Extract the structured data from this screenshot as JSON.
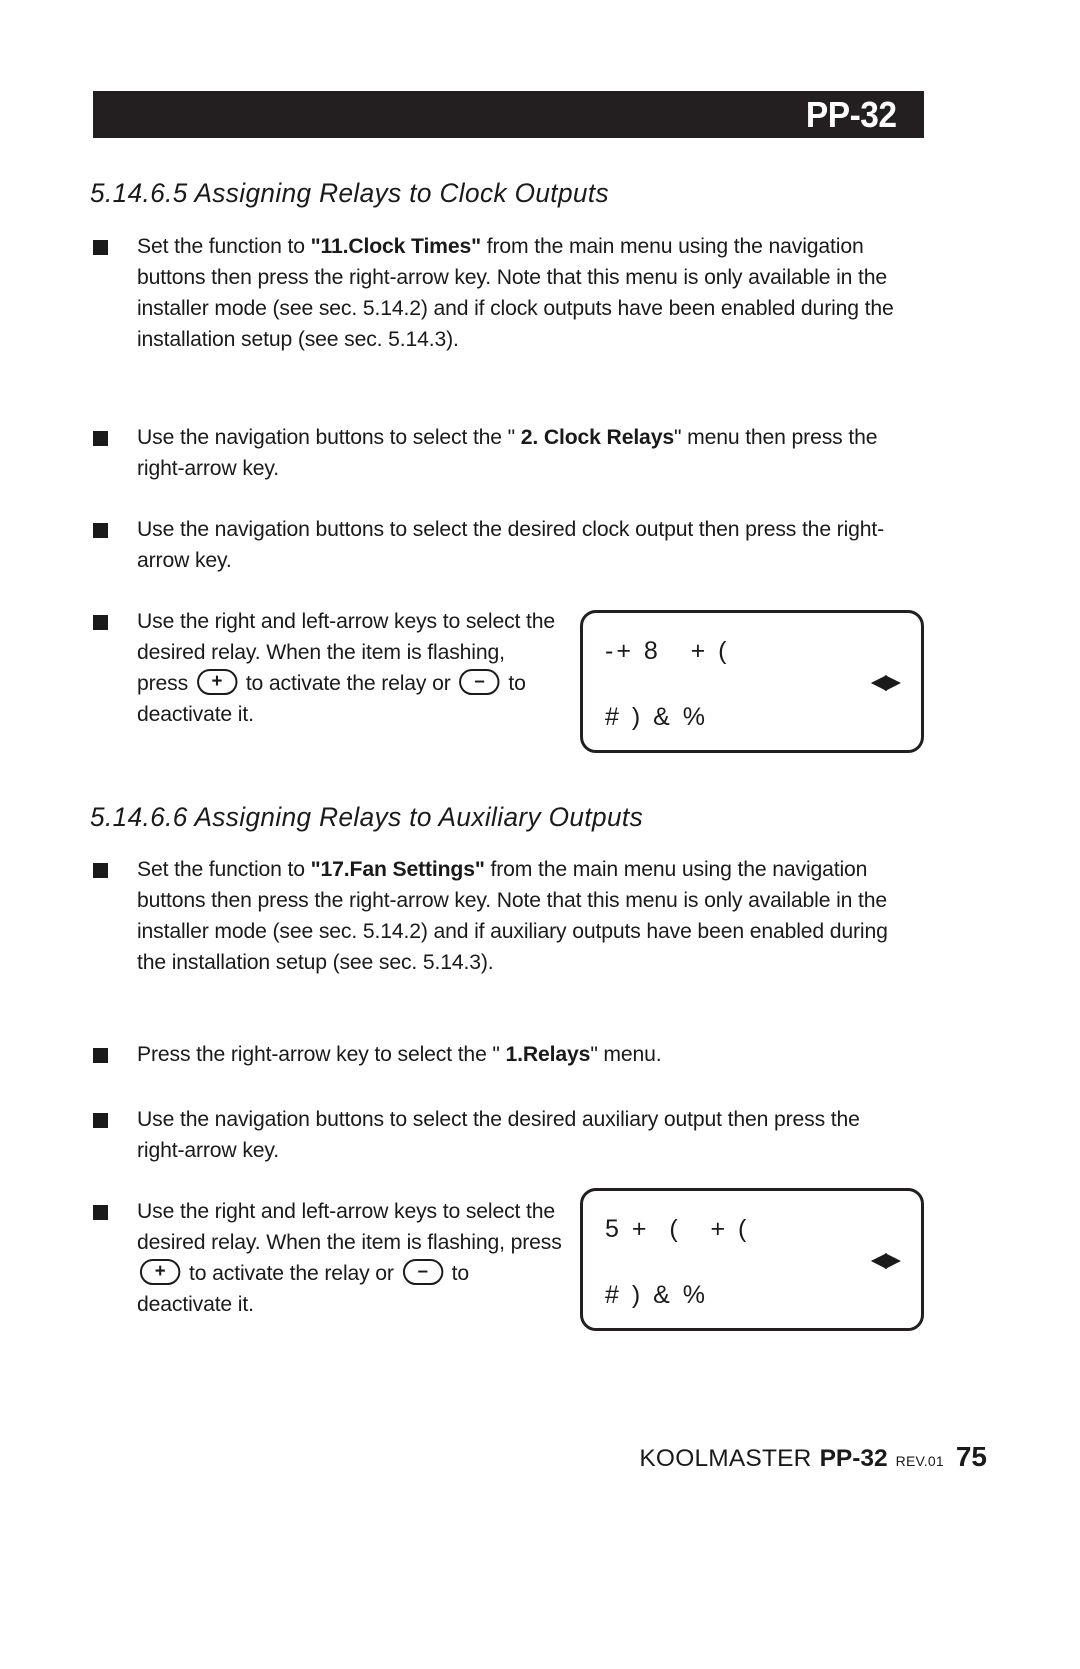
{
  "header": {
    "title": "PP-32"
  },
  "sections": [
    {
      "heading": "5.14.6.5 Assigning Relays to Clock Outputs"
    },
    {
      "heading": "5.14.6.6 Assigning Relays to Auxiliary Outputs"
    }
  ],
  "bullets": {
    "b1": {
      "part1": "Set the function to ",
      "bold": "\"11.Clock Times\"",
      "part2": " from the  main menu using the navigation buttons then press the right-arrow key. Note that this menu is only available in the installer mode (see sec. 5.14.2) and if clock outputs have been enabled during the installation setup (see sec. 5.14.3)."
    },
    "b2": {
      "part1": "Use the navigation buttons to select the \"  ",
      "bold": "2. Clock Relays",
      "part2": "\" menu then press the right-arrow key."
    },
    "b3": {
      "text": "Use the navigation buttons to select the desired clock output then press the right-arrow key."
    },
    "b4": {
      "part1": "Use the right and left-arrow keys to select the desired relay. When the item is flashing, press ",
      "key_plus": "+",
      "part2": " to activate the relay or ",
      "key_minus": "–",
      "part3": " to deactivate it."
    },
    "b5": {
      "part1": "Set the function to ",
      "bold": "\"17.Fan Settings\"",
      "part2": " from the  main menu using the navigation buttons then press the right-arrow key. Note that this menu is only available in the installer mode (see sec. 5.14.2) and if auxiliary outputs have been enabled during the installation setup (see sec. 5.14.3)."
    },
    "b6": {
      "part1": "Press the right-arrow key  to select the \"  ",
      "bold": "1.Relays",
      "part2": "\" menu."
    },
    "b7": {
      "text": "Use the navigation buttons to select the desired auxiliary output then press the right-arrow key."
    },
    "b8": {
      "part1": "Use the right and left-arrow keys to select the desired relay. When the item is flashing, press ",
      "key_plus": "+",
      "part2": " to activate the relay or ",
      "key_minus": "–",
      "part3": " to deactivate it."
    }
  },
  "lcd_displays": [
    {
      "line1": "-+ 8   + (",
      "line2": "# ) & %",
      "arrows": "◀▶"
    },
    {
      "line1": "5 +  (   + (",
      "line2": "# ) & %",
      "arrows": "◀▶"
    }
  ],
  "footer": {
    "brand": "KOOLMASTER",
    "model": "PP-32",
    "revision": "REV.01",
    "page_number": "75"
  },
  "colors": {
    "header_bar": "#231f20",
    "text": "#1a1a1a",
    "page_background": "#ffffff"
  }
}
